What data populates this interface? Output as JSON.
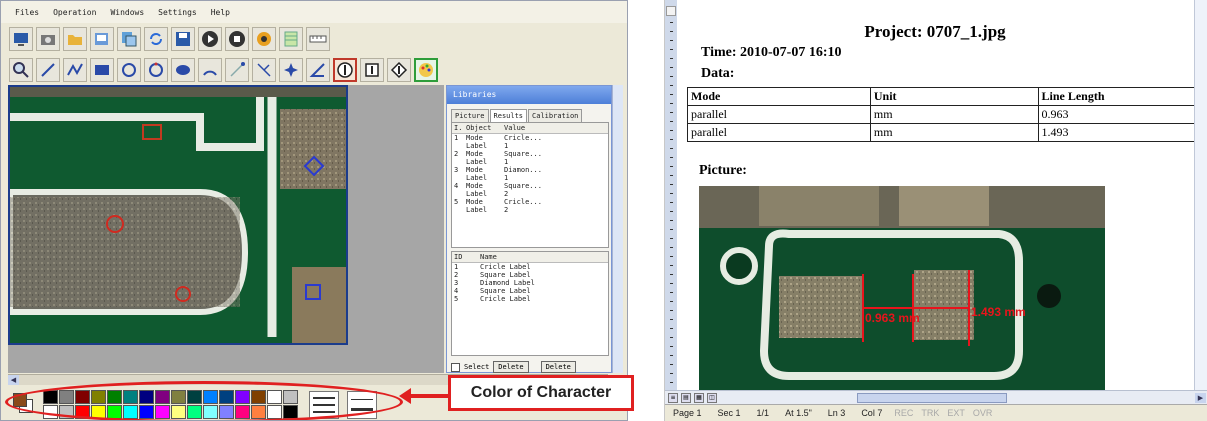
{
  "menu": [
    "Files",
    "Operation",
    "Windows",
    "Settings",
    "Help"
  ],
  "libraries": {
    "title": "Libraries",
    "tabs": [
      "Picture",
      "Results",
      "Calibration"
    ],
    "active_tab": "Results",
    "results_header": [
      "I.",
      "Object",
      "Value"
    ],
    "results_rows": [
      [
        "1",
        "Mode",
        "Cricle..."
      ],
      [
        "",
        "Label",
        "1"
      ],
      [
        "2",
        "Mode",
        "Square..."
      ],
      [
        "",
        "Label",
        "1"
      ],
      [
        "3",
        "Mode",
        "Diamon..."
      ],
      [
        "",
        "Label",
        "1"
      ],
      [
        "4",
        "Mode",
        "Square..."
      ],
      [
        "",
        "Label",
        "2"
      ],
      [
        "5",
        "Mode",
        "Cricle..."
      ],
      [
        "",
        "Label",
        "2"
      ]
    ],
    "names_header": [
      "ID",
      "Name"
    ],
    "names_rows": [
      [
        "1",
        "Cricle Label"
      ],
      [
        "2",
        "Square Label"
      ],
      [
        "3",
        "Diamond Label"
      ],
      [
        "4",
        "Square Label"
      ],
      [
        "5",
        "Cricle Label"
      ]
    ],
    "select_label": "Select",
    "delete_label": "Delete",
    "delete_all_label": "Delete"
  },
  "palette": {
    "current_color": "#8a4a1a",
    "colors": [
      "#000000",
      "#808080",
      "#800000",
      "#808000",
      "#008000",
      "#008080",
      "#000080",
      "#800080",
      "#808040",
      "#004040",
      "#0080ff",
      "#004080",
      "#8000ff",
      "#804000",
      "#ffffff",
      "#c0c0c0",
      "#ffffff",
      "#c0c0c0",
      "#ff0000",
      "#ffff00",
      "#00ff00",
      "#00ffff",
      "#0000ff",
      "#ff00ff",
      "#ffff80",
      "#00ff80",
      "#80ffff",
      "#8080ff",
      "#ff0080",
      "#ff8040",
      "#ffffff",
      "#000000"
    ]
  },
  "callout_label": "Color of Character",
  "report": {
    "title": "Project: 0707_1.jpg",
    "time": "Time: 2010-07-07  16:10",
    "data_heading": "Data:",
    "table_headers": [
      "Mode",
      "Unit",
      "Line Length"
    ],
    "table_rows": [
      [
        "parallel",
        "mm",
        "0.963"
      ],
      [
        "parallel",
        "mm",
        "1.493"
      ]
    ],
    "picture_heading": "Picture:",
    "image_labels": [
      "0.963 mm",
      "1.493 mm"
    ]
  },
  "status": {
    "page": "Page 1",
    "sec": "Sec 1",
    "pages": "1/1",
    "at": "At 1.5\"",
    "ln": "Ln 3",
    "col": "Col 7",
    "modes": [
      "REC",
      "TRK",
      "EXT",
      "OVR"
    ]
  },
  "colors": {
    "accent_red": "#e02020",
    "measure_red": "#e8141c",
    "board_green": "#0e4d2c"
  }
}
